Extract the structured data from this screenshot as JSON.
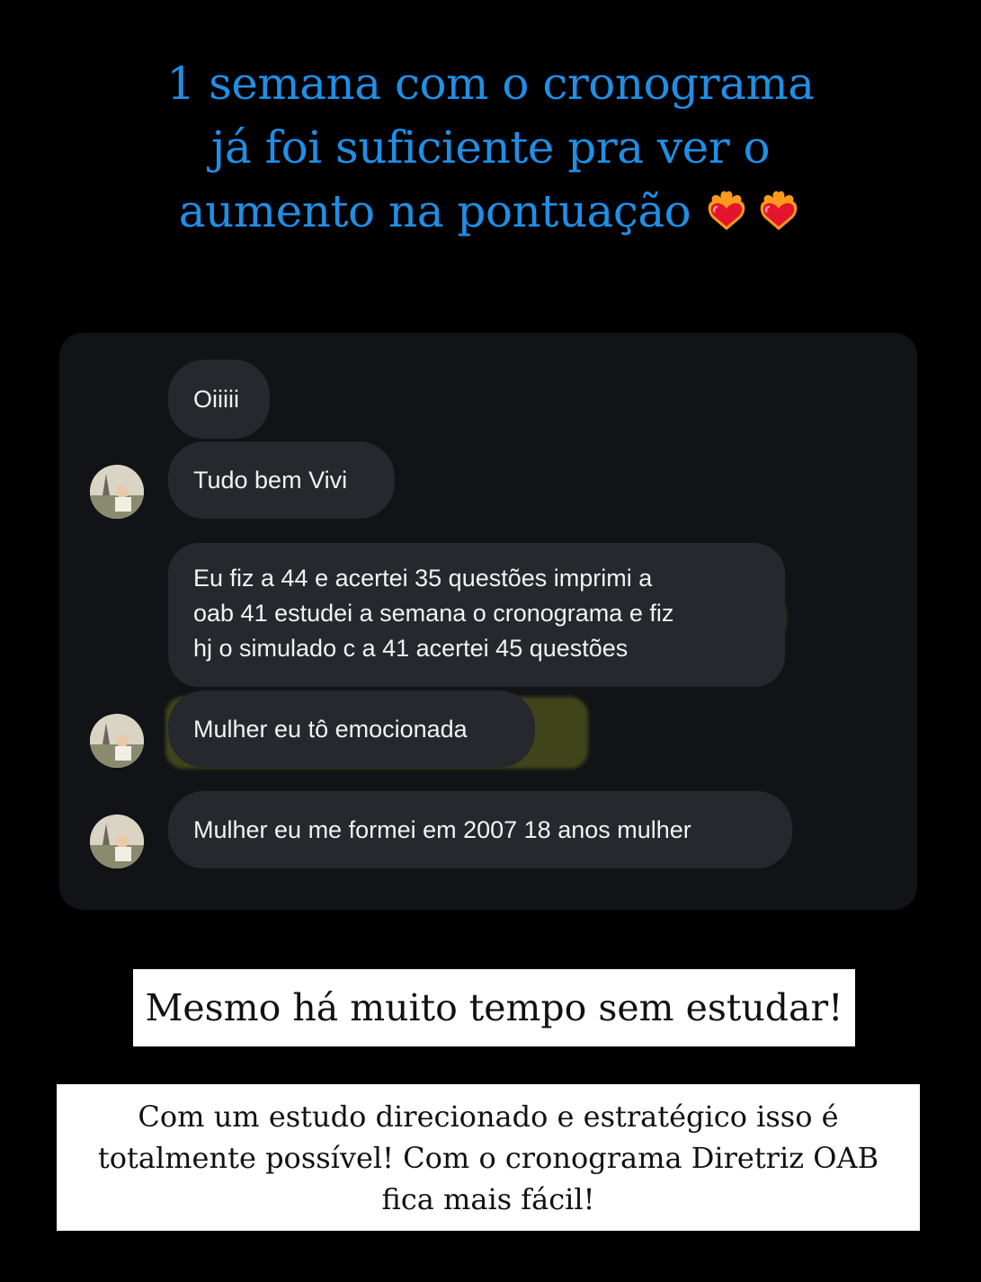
{
  "headline": {
    "line1": "1 semana com o cronograma",
    "line2": "já foi suficiente pra ver o",
    "line3": "aumento na pontuação",
    "icons": [
      "heart-on-fire-icon",
      "heart-on-fire-icon"
    ]
  },
  "chat": {
    "messages": [
      {
        "text": "Oiiiii"
      },
      {
        "text": "Tudo bem Vivi"
      },
      {
        "lines": [
          "Eu fiz a 44 e acertei 35 questões imprimi a",
          "oab 41  estudei a semana o cronograma e fiz",
          "hj o simulado c a 41 acertei 45 questões"
        ]
      },
      {
        "text": "Mulher eu tô emocionada"
      },
      {
        "text": "Mulher eu me formei em 2007 18 anos mulher"
      }
    ],
    "highlight_color": "#bec428"
  },
  "box1": {
    "text": "Mesmo há muito tempo sem estudar!"
  },
  "box2": {
    "lines": [
      "Com um estudo direcionado e estratégico isso é",
      "totalmente possível! Com o cronograma Diretriz OAB",
      "fica mais fácil!"
    ]
  },
  "colors": {
    "headline": "#1f8fe6",
    "background": "#000000",
    "bubble": "#26282d"
  }
}
